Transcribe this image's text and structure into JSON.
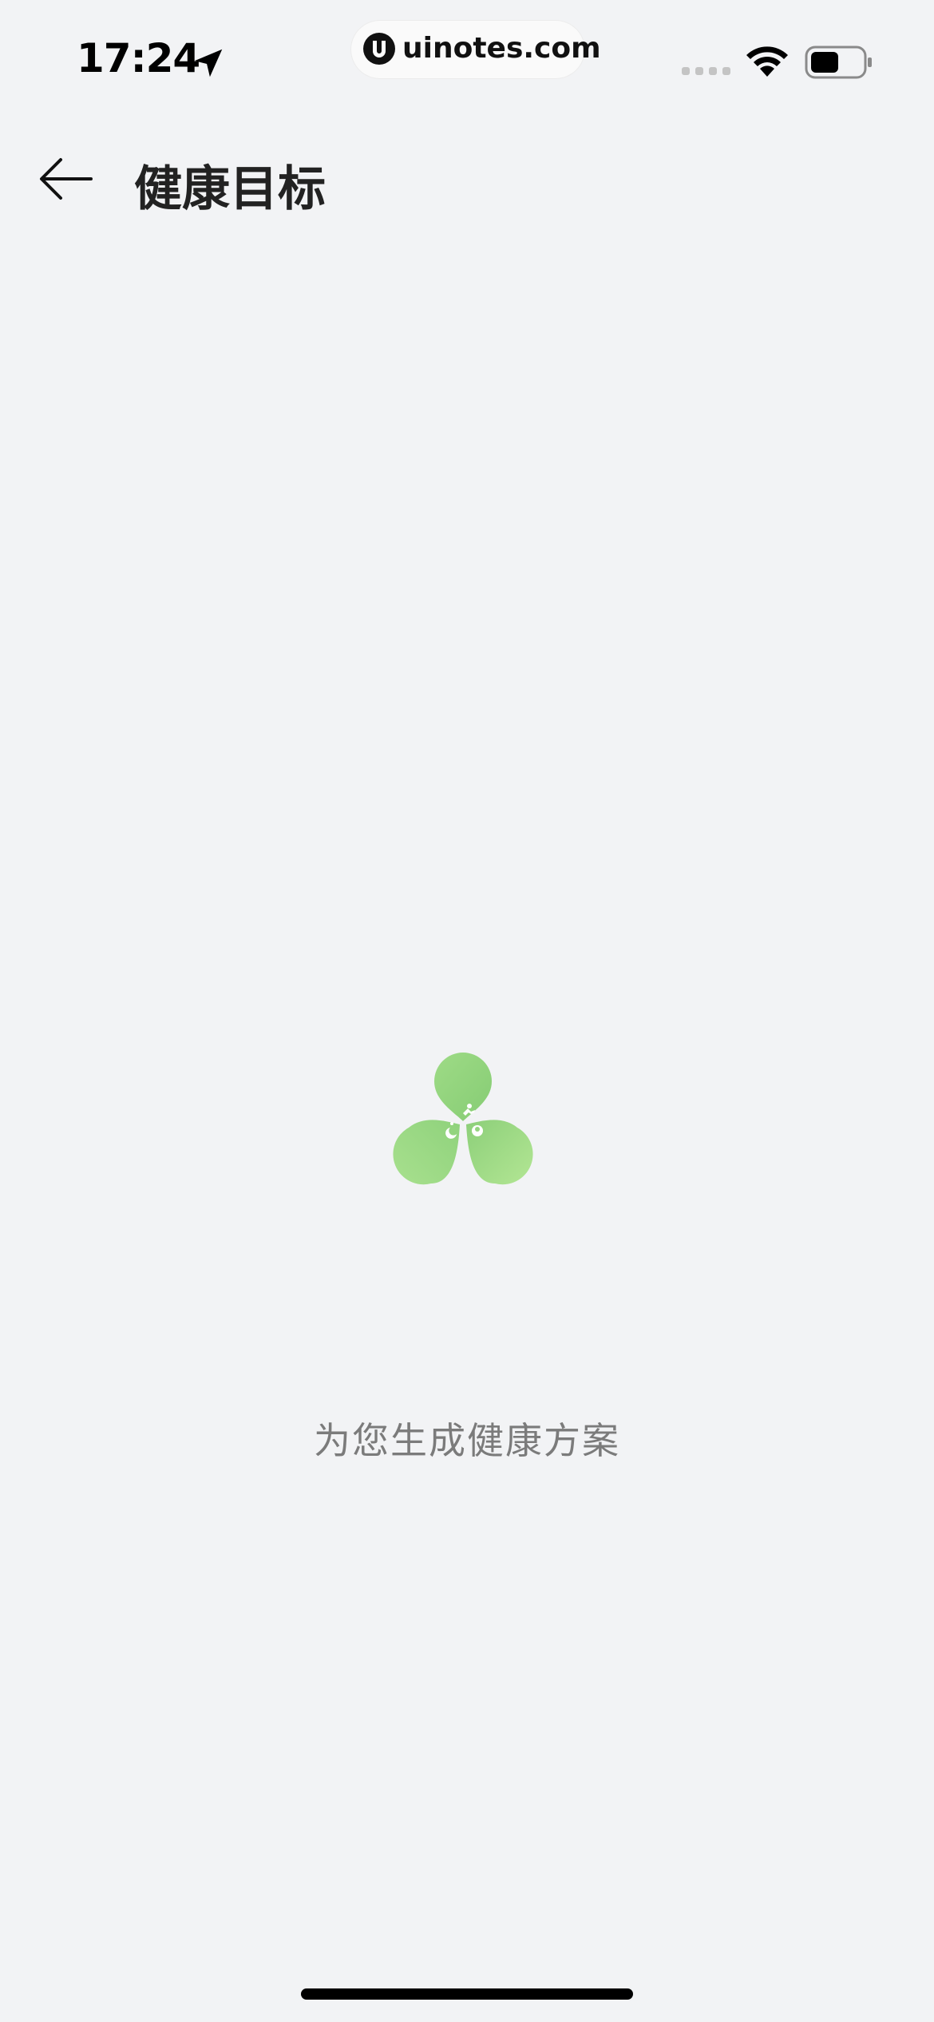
{
  "status_bar": {
    "time": "17:24",
    "url": "uinotes.com",
    "icons": [
      "location-arrow-icon",
      "uinotes-logo-icon",
      "cellular-signal-icon",
      "wifi-icon",
      "battery-icon"
    ]
  },
  "header": {
    "back_icon": "arrow-left-icon",
    "title": "健康目标"
  },
  "main": {
    "logo_icon": "clover-logo-icon",
    "loading_text": "为您生成健康方案"
  },
  "colors": {
    "background": "#f2f3f5",
    "clover_green": "#8fd47c",
    "text_secondary": "#7b7b7b"
  }
}
